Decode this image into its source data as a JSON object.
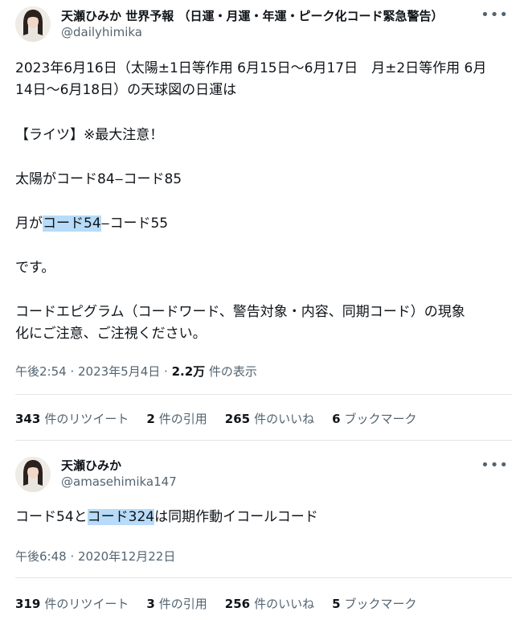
{
  "tweets": [
    {
      "author": {
        "name": "天瀬ひみか 世界予報 （日運・月運・年運・ピーク化コード緊急警告）",
        "handle": "@dailyhimika"
      },
      "more_icon": "more-horizontal-icon",
      "body": {
        "line1": "2023年6月16日（太陽±1日等作用 6月15日〜6月17日　月±2日等作用 6月",
        "line2": "14日〜6月18日）の天球図の日運は",
        "line3": "【ライツ】※最大注意！",
        "line4": "太陽がコード84‒コード85",
        "line5_pre": "月が",
        "line5_hl": "コード54",
        "line5_post": "‒コード55",
        "line6": "です。",
        "line7": "コードエピグラム（コードワード、警告対象・内容、同期コード）の現象",
        "line8": "化にご注意、ご注視ください。"
      },
      "meta": {
        "time": "午後2:54 · 2023年5月4日 · ",
        "views_count": "2.2万",
        "views_label": " 件の表示"
      },
      "stats": [
        {
          "count": "343",
          "label": "件のリツイート"
        },
        {
          "count": "2",
          "label": "件の引用"
        },
        {
          "count": "265",
          "label": "件のいいね"
        },
        {
          "count": "6",
          "label": "ブックマーク"
        }
      ]
    },
    {
      "author": {
        "name": "天瀬ひみか",
        "handle": "@amasehimika147"
      },
      "more_icon": "more-horizontal-icon",
      "body": {
        "pre": "コード54と",
        "hl": "コード324",
        "post": "は同期作動イコールコード"
      },
      "meta": {
        "time": "午後6:48 · 2020年12月22日"
      },
      "stats": [
        {
          "count": "319",
          "label": "件のリツイート"
        },
        {
          "count": "3",
          "label": "件の引用"
        },
        {
          "count": "256",
          "label": "件のいいね"
        },
        {
          "count": "5",
          "label": "ブックマーク"
        }
      ]
    }
  ],
  "colors": {
    "text": "#0f1419",
    "secondary": "#536471",
    "highlight": "#b7dbf8",
    "divider": "#e1e5e8"
  }
}
